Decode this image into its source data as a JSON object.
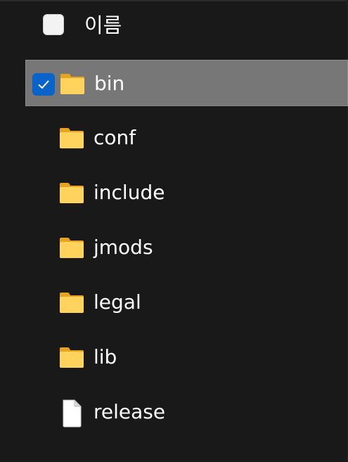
{
  "header": {
    "column_label": "이름"
  },
  "items": [
    {
      "name": "bin",
      "type": "folder",
      "selected": true
    },
    {
      "name": "conf",
      "type": "folder",
      "selected": false
    },
    {
      "name": "include",
      "type": "folder",
      "selected": false
    },
    {
      "name": "jmods",
      "type": "folder",
      "selected": false
    },
    {
      "name": "legal",
      "type": "folder",
      "selected": false
    },
    {
      "name": "lib",
      "type": "folder",
      "selected": false
    },
    {
      "name": "release",
      "type": "file",
      "selected": false
    }
  ],
  "colors": {
    "background": "#191919",
    "selection": "#777777",
    "checkbox_checked": "#0a63c9",
    "folder": "#ffd35c"
  }
}
